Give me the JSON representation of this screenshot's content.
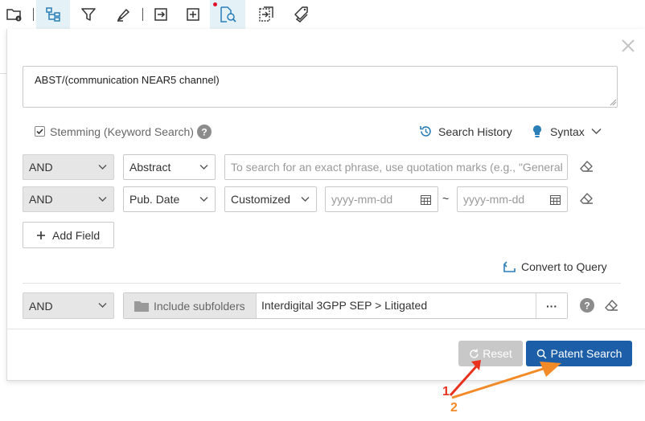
{
  "toolbar": {
    "icons": [
      "folder-info-icon",
      "tree-view-icon",
      "filter-icon",
      "highlighter-icon",
      "export-icon",
      "add-box-icon",
      "search-document-icon",
      "compare-icon",
      "tags-icon"
    ]
  },
  "query": {
    "text": "ABST/(communication NEAR5 channel)"
  },
  "options": {
    "stemming_label": "Stemming (Keyword Search)",
    "stemming_checked": true,
    "search_history_label": "Search History",
    "syntax_label": "Syntax"
  },
  "rows": [
    {
      "operator": "AND",
      "field": "Abstract",
      "placeholder": "To search for an exact phrase, use quotation marks (e.g., \"General"
    },
    {
      "operator": "AND",
      "field": "Pub. Date",
      "mode": "Customized",
      "from_placeholder": "yyyy-mm-dd",
      "separator": "~",
      "to_placeholder": "yyyy-mm-dd"
    }
  ],
  "add_field_label": "Add Field",
  "convert_label": "Convert to Query",
  "folder_row": {
    "operator": "AND",
    "include_subfolders_label": "Include subfolders",
    "path": "Interdigital 3GPP SEP > Litigated",
    "more": "···"
  },
  "buttons": {
    "reset": "Reset",
    "search": "Patent Search"
  },
  "annotations": {
    "one": "1",
    "two": "2"
  },
  "colors": {
    "primary": "#1c5fa8",
    "accent_icon": "#2a7fb8",
    "arrow1": "#e8321e",
    "arrow2": "#f28a28",
    "active_tab": "#e4f1f6"
  }
}
